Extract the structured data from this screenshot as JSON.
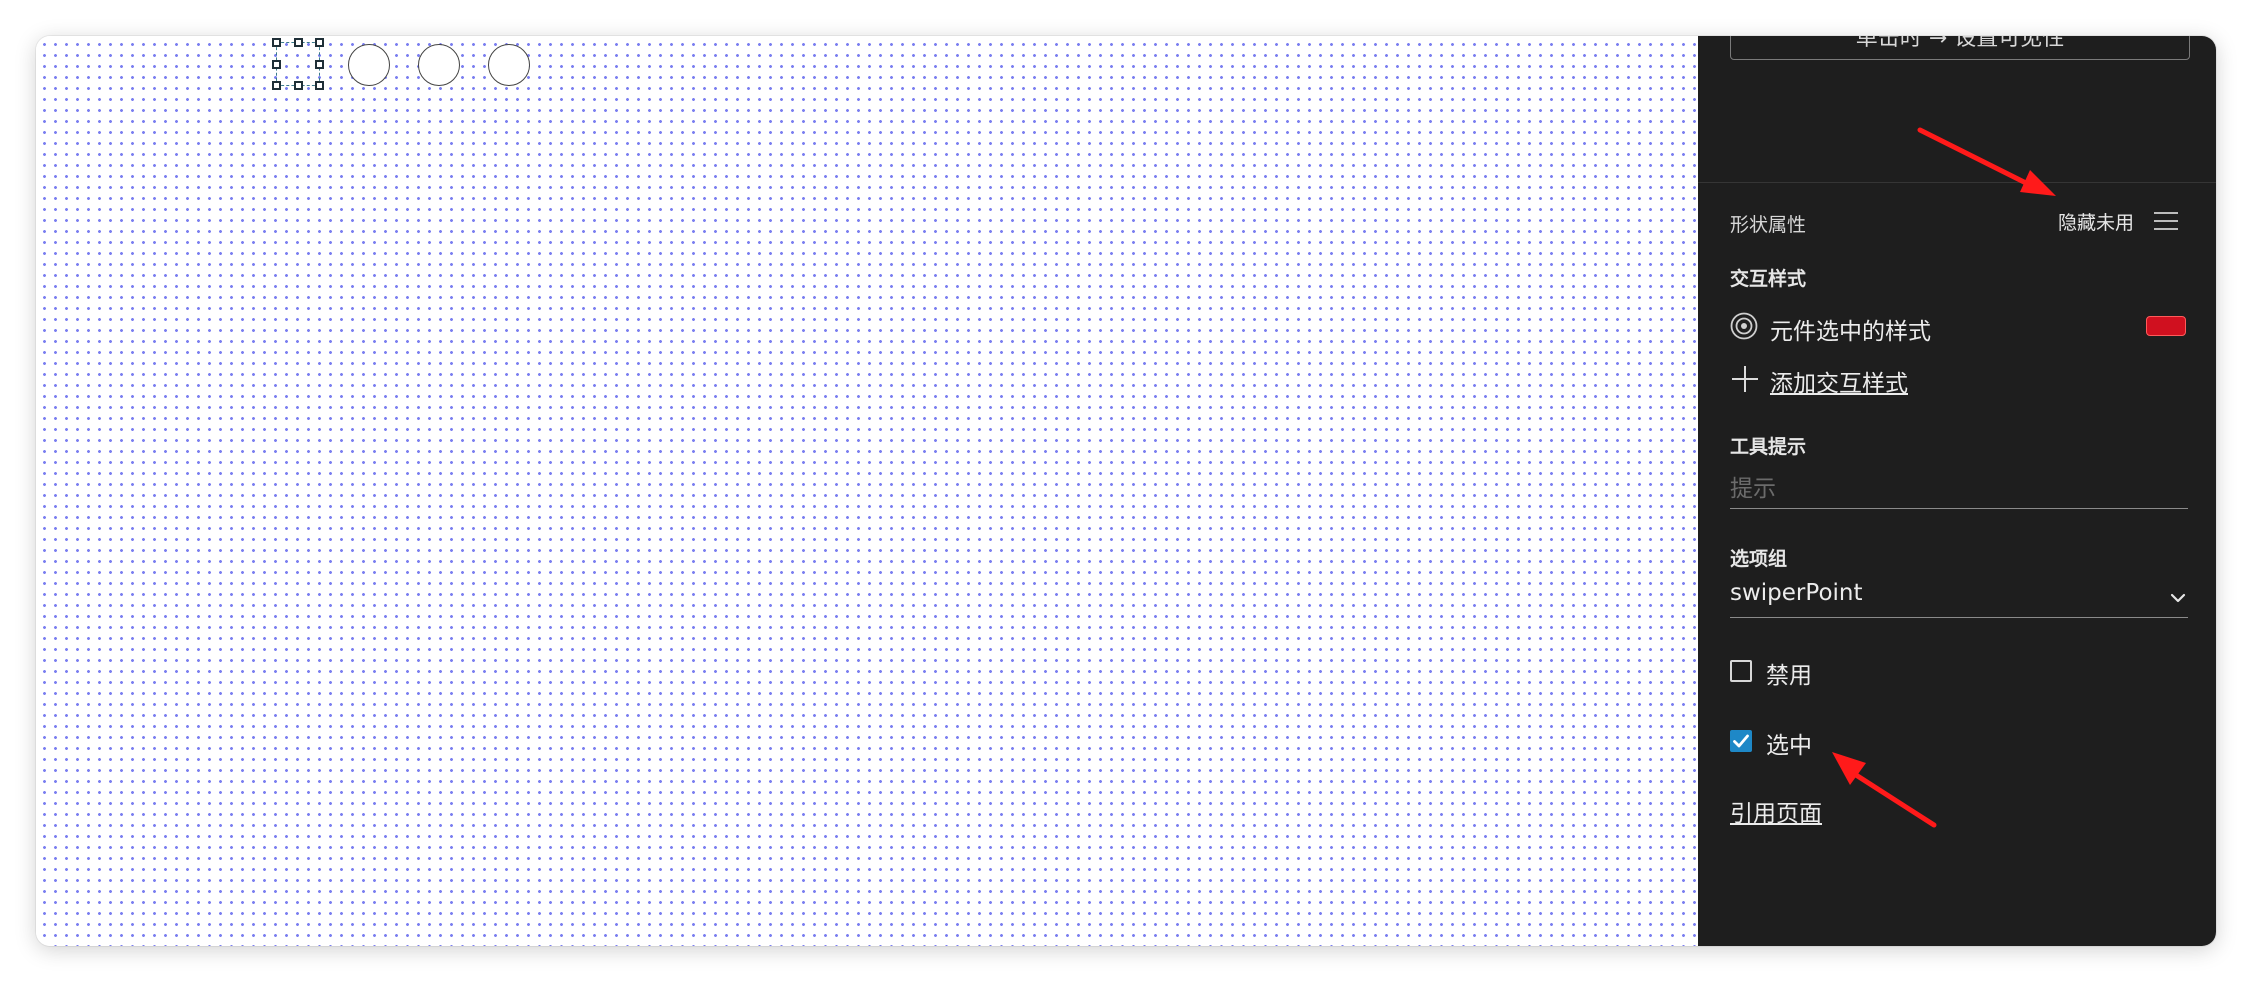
{
  "panel": {
    "action_button_label": "单击时 → 设置可见性",
    "section_title": "形状属性",
    "hide_unused_label": "隐藏未用",
    "interaction_styles": {
      "heading": "交互样式",
      "items": [
        {
          "label": "元件选中的样式",
          "icon": "target-icon",
          "swatch_color": "#d0101f"
        }
      ],
      "add_label": "添加交互样式"
    },
    "tooltip": {
      "heading": "工具提示",
      "placeholder": "提示",
      "value": ""
    },
    "option_group": {
      "heading": "选项组",
      "selected_value": "swiperPoint"
    },
    "disabled": {
      "label": "禁用",
      "checked": false
    },
    "selected": {
      "label": "选中",
      "checked": true
    },
    "reference_page_label": "引用页面"
  },
  "canvas": {
    "grid_dot_color": "#7b7ff0",
    "shapes": [
      {
        "kind": "selected-square",
        "state": "selected"
      },
      {
        "kind": "circle"
      },
      {
        "kind": "circle"
      },
      {
        "kind": "circle"
      }
    ]
  },
  "annotations": {
    "arrow_color": "#ff1a1a"
  }
}
